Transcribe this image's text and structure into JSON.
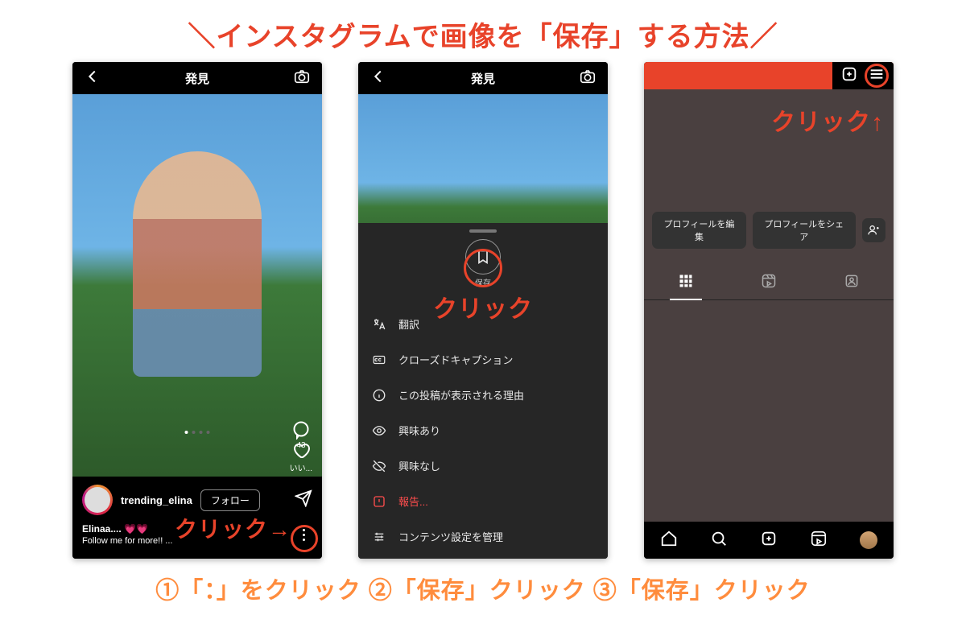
{
  "title_full": "＼インスタグラムで画像を「保存」する方法／",
  "annotations": {
    "click_right": "クリック→",
    "click": "クリック",
    "click_up": "クリック↑"
  },
  "bottom_caption": "①「：」をクリック ②「保存」クリック ③「保存」クリック",
  "phone1": {
    "header_title": "発見",
    "like_label": "いい...",
    "comment_count": "43",
    "username": "trending_elina",
    "follow_label": "フォロー",
    "caption1": "Elinaa.... 💗💗",
    "caption2": "Follow me for more!! ..."
  },
  "phone2": {
    "header_title": "発見",
    "save_label": "保存",
    "menu": [
      {
        "label": "翻訳"
      },
      {
        "label": "クローズドキャプション"
      },
      {
        "label": "この投稿が表示される理由"
      },
      {
        "label": "興味あり"
      },
      {
        "label": "興味なし"
      },
      {
        "label": "報告..."
      },
      {
        "label": "コンテンツ設定を管理"
      }
    ]
  },
  "phone3": {
    "edit_profile": "プロフィールを編集",
    "share_profile": "プロフィールをシェア"
  }
}
